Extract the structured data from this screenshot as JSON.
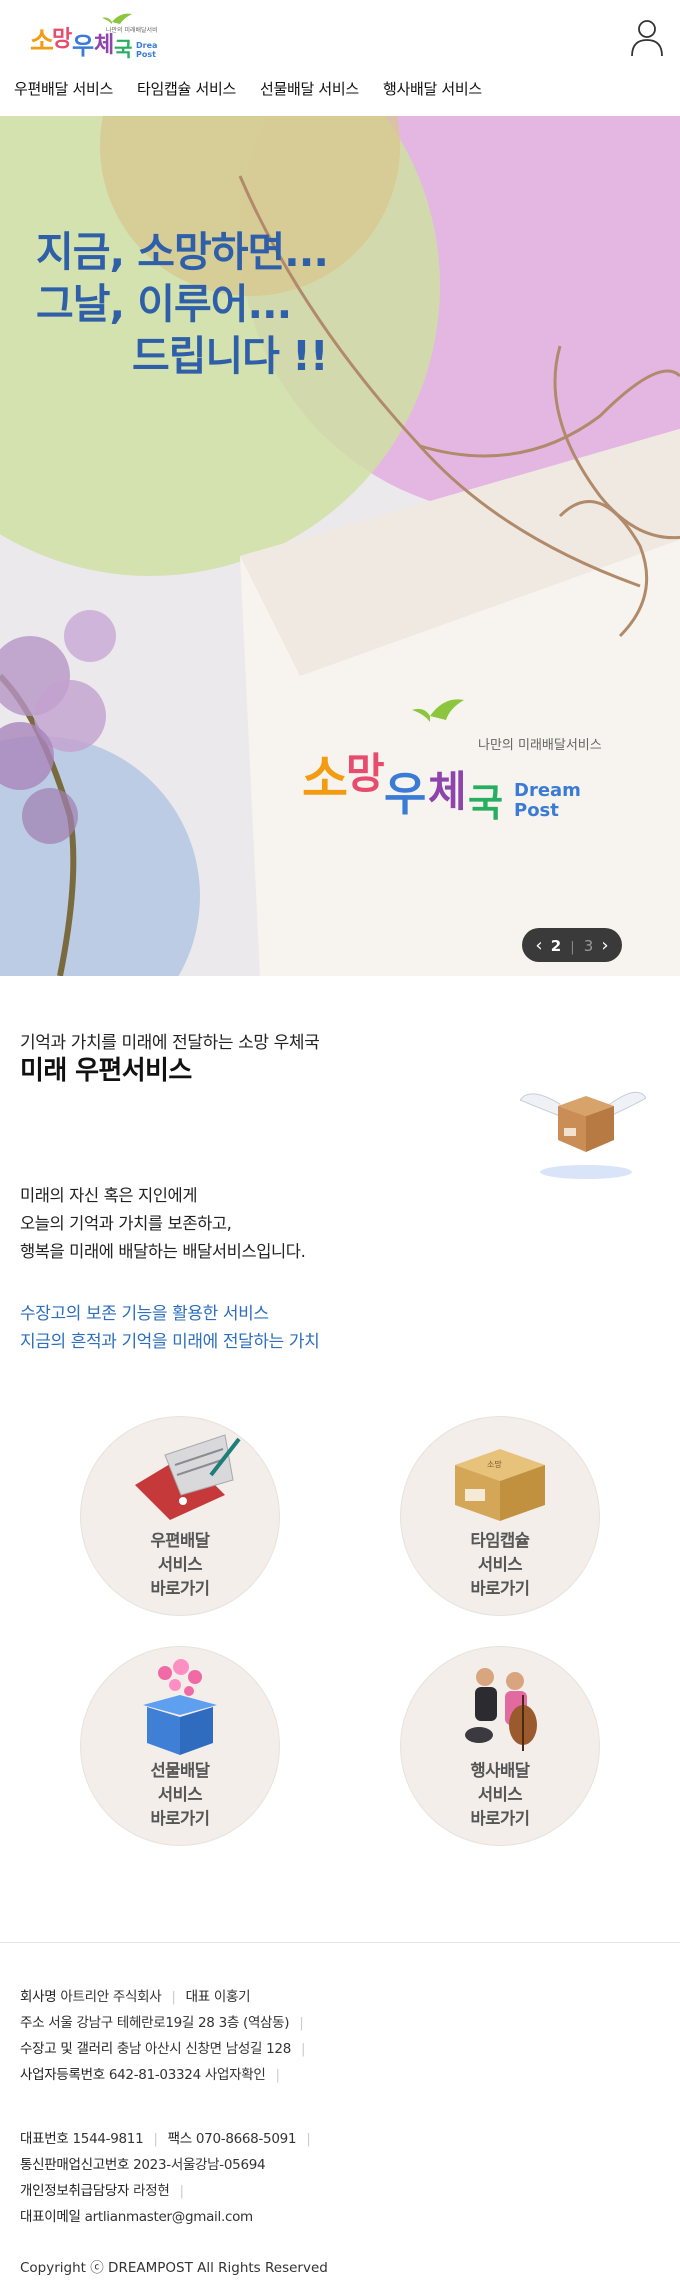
{
  "header": {
    "logo_text_main": "소망우체국",
    "logo_text_sub": "나만의 미래배달서비스",
    "logo_text_en1": "Dream",
    "logo_text_en2": "Post",
    "nav": [
      "우편배달 서비스",
      "타임캡슐 서비스",
      "선물배달 서비스",
      "행사배달 서비스"
    ]
  },
  "hero": {
    "line1": "지금, 소망하면...",
    "line2": "그날, 이루어...",
    "line3": "드립니다 !!",
    "slider": {
      "current": "2",
      "separator": "|",
      "total": "3"
    }
  },
  "intro": {
    "subtitle": "기억과 가치를 미래에 전달하는 소망 우체국",
    "title": "미래 우편서비스",
    "body": [
      "미래의 자신 혹은 지인에게",
      "오늘의 기억과 가치를 보존하고,",
      "행복을 미래에 배달하는 배달서비스입니다."
    ],
    "highlight": [
      "수장고의 보존 기능을 활용한 서비스",
      "지금의 흔적과 기억을 미래에 전달하는 가치"
    ]
  },
  "services": [
    {
      "label": [
        "우편배달",
        "서비스",
        "바로가기"
      ]
    },
    {
      "label": [
        "타임캡슐",
        "서비스",
        "바로가기"
      ]
    },
    {
      "label": [
        "선물배달",
        "서비스",
        "바로가기"
      ]
    },
    {
      "label": [
        "행사배달",
        "서비스",
        "바로가기"
      ]
    }
  ],
  "footer": {
    "company_k": "회사명",
    "company_v": "아트리안 주식회사",
    "ceo_k": "대표",
    "ceo_v": "이홍기",
    "addr_k": "주소",
    "addr_v": "서울 강남구 테헤란로19길 28 3층 (역삼동)",
    "storage_k": "수장고 및 갤러리",
    "storage_v": "충남 아산시 신창면 남성길 128",
    "biz_k": "사업자등록번호",
    "biz_v": "642-81-03324",
    "biz_link": "사업자확인",
    "tel_k": "대표번호",
    "tel_v": "1544-9811",
    "fax_k": "팩스",
    "fax_v": "070-8668-5091",
    "mail_order_k": "통신판매업신고번호",
    "mail_order_v": "2023-서울강남-05694",
    "privacy_k": "개인정보취급담당자",
    "privacy_v": "라정현",
    "email_k": "대표이메일",
    "email_v": "artlianmaster@gmail.com",
    "copyright": "Copyright ⓒ DREAMPOST All Rights Reserved"
  }
}
